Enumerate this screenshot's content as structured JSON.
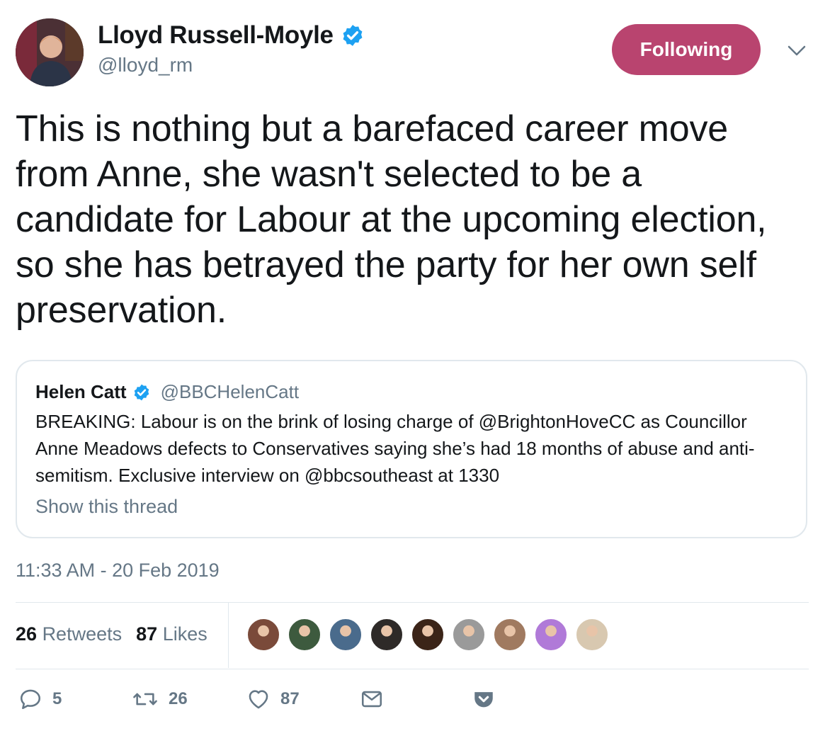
{
  "author": {
    "display_name": "Lloyd Russell-Moyle",
    "handle": "@lloyd_rm",
    "verified": true
  },
  "follow_button": {
    "label": "Following",
    "color": "#b9446f"
  },
  "tweet": {
    "text": "This is nothing but a barefaced career move from Anne, she wasn't selected to be a candidate for Labour at the upcoming election, so she has betrayed the party for her own self preservation.",
    "timestamp": "11:33 AM - 20 Feb 2019"
  },
  "quoted_tweet": {
    "display_name": "Helen Catt",
    "handle": "@BBCHelenCatt",
    "verified": true,
    "text": "BREAKING: Labour is on the brink of losing charge of @BrightonHoveCC as Councillor Anne Meadows defects to Conservatives saying she’s had 18 months of abuse and anti-semitism. Exclusive interview on @bbcsoutheast at 1330",
    "show_thread_label": "Show this thread"
  },
  "stats": {
    "retweets_count": "26",
    "retweets_label": "Retweets",
    "likes_count": "87",
    "likes_label": "Likes"
  },
  "likers": [
    {
      "icon": "avatar",
      "color": "#7a4a3a"
    },
    {
      "icon": "avatar",
      "color": "#3d5a3e"
    },
    {
      "icon": "avatar",
      "color": "#4a6b8c"
    },
    {
      "icon": "avatar",
      "color": "#2e2a28"
    },
    {
      "icon": "avatar",
      "color": "#3b2418"
    },
    {
      "icon": "avatar",
      "color": "#9a9a9a"
    },
    {
      "icon": "avatar",
      "color": "#a07a60"
    },
    {
      "icon": "avatar",
      "color": "#b07ad8"
    },
    {
      "icon": "avatar",
      "color": "#d8c8b0"
    }
  ],
  "actions": {
    "reply_count": "5",
    "retweet_count": "26",
    "like_count": "87"
  },
  "colors": {
    "verified": "#1da1f2",
    "secondary_text": "#657786",
    "border": "#e1e8ed"
  }
}
